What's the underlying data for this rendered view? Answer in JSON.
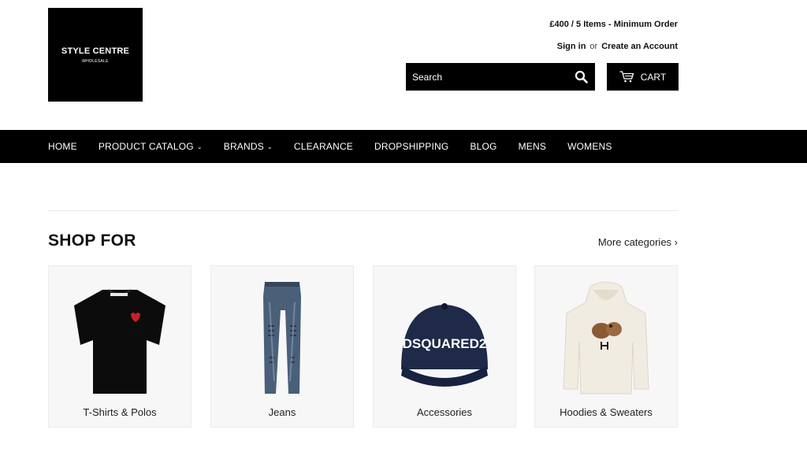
{
  "logo": {
    "title": "STYLE CENTRE",
    "subtitle": "WHOLESALE"
  },
  "header": {
    "minimum_order": "£400 / 5 Items - Minimum Order",
    "sign_in": "Sign in",
    "or": "or",
    "create_account": "Create an Account",
    "search_placeholder": "Search",
    "cart_label": "CART"
  },
  "nav": {
    "items": [
      {
        "label": "HOME",
        "dropdown": false
      },
      {
        "label": "PRODUCT CATALOG",
        "dropdown": true
      },
      {
        "label": "BRANDS",
        "dropdown": true
      },
      {
        "label": "CLEARANCE",
        "dropdown": false
      },
      {
        "label": "DROPSHIPPING",
        "dropdown": false
      },
      {
        "label": "BLOG",
        "dropdown": false
      },
      {
        "label": "MENS",
        "dropdown": false
      },
      {
        "label": "WOMENS",
        "dropdown": false
      }
    ]
  },
  "shop": {
    "title": "SHOP FOR",
    "more_categories": "More categories ›",
    "categories": [
      {
        "label": "T-Shirts & Polos",
        "icon": "tshirt-image"
      },
      {
        "label": "Jeans",
        "icon": "jeans-image"
      },
      {
        "label": "Accessories",
        "icon": "cap-image",
        "print": "DSQUARED2"
      },
      {
        "label": "Hoodies & Sweaters",
        "icon": "hoodie-image"
      }
    ]
  },
  "colors": {
    "primary": "#000000",
    "text": "#111111",
    "card_bg": "#f7f7f7",
    "cap_navy": "#1e2a48",
    "jeans_blue": "#4a5f78",
    "hoodie_cream": "#f1ece2"
  }
}
